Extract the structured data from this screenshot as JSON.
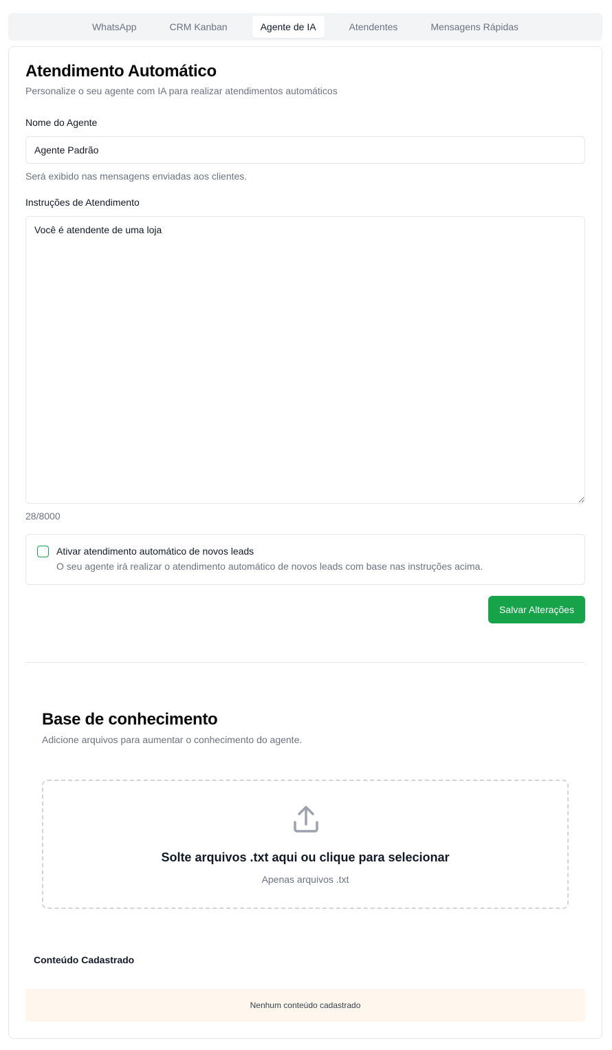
{
  "tabs": [
    {
      "label": "WhatsApp",
      "active": false
    },
    {
      "label": "CRM Kanban",
      "active": false
    },
    {
      "label": "Agente de IA",
      "active": true
    },
    {
      "label": "Atendentes",
      "active": false
    },
    {
      "label": "Mensagens Rápidas",
      "active": false
    }
  ],
  "header": {
    "title": "Atendimento Automático",
    "subtitle": "Personalize o seu agente com IA para realizar atendimentos automáticos"
  },
  "agent_name": {
    "label": "Nome do Agente",
    "value": "Agente Padrão",
    "hint": "Será exibido nas mensagens enviadas aos clientes."
  },
  "instructions": {
    "label": "Instruções de Atendimento",
    "value": "Você é atendente de uma loja",
    "counter": "28/8000"
  },
  "auto_leads": {
    "checked": false,
    "label": "Ativar atendimento automático de novos leads",
    "description": "O seu agente irá realizar o atendimento automático de novos leads com base nas instruções acima."
  },
  "save_label": "Salvar Alterações",
  "knowledge_base": {
    "title": "Base de conhecimento",
    "subtitle": "Adicione arquivos para aumentar o conhecimento do agente.",
    "dropzone_icon": "upload-icon",
    "dropzone_title": "Solte arquivos .txt aqui ou clique para selecionar",
    "dropzone_hint": "Apenas arquivos .txt"
  },
  "content": {
    "title": "Conteúdo Cadastrado",
    "empty_message": "Nenhum conteúdo cadastrado"
  },
  "colors": {
    "accent": "#16a34a",
    "empty_bg": "#fff7ed"
  }
}
